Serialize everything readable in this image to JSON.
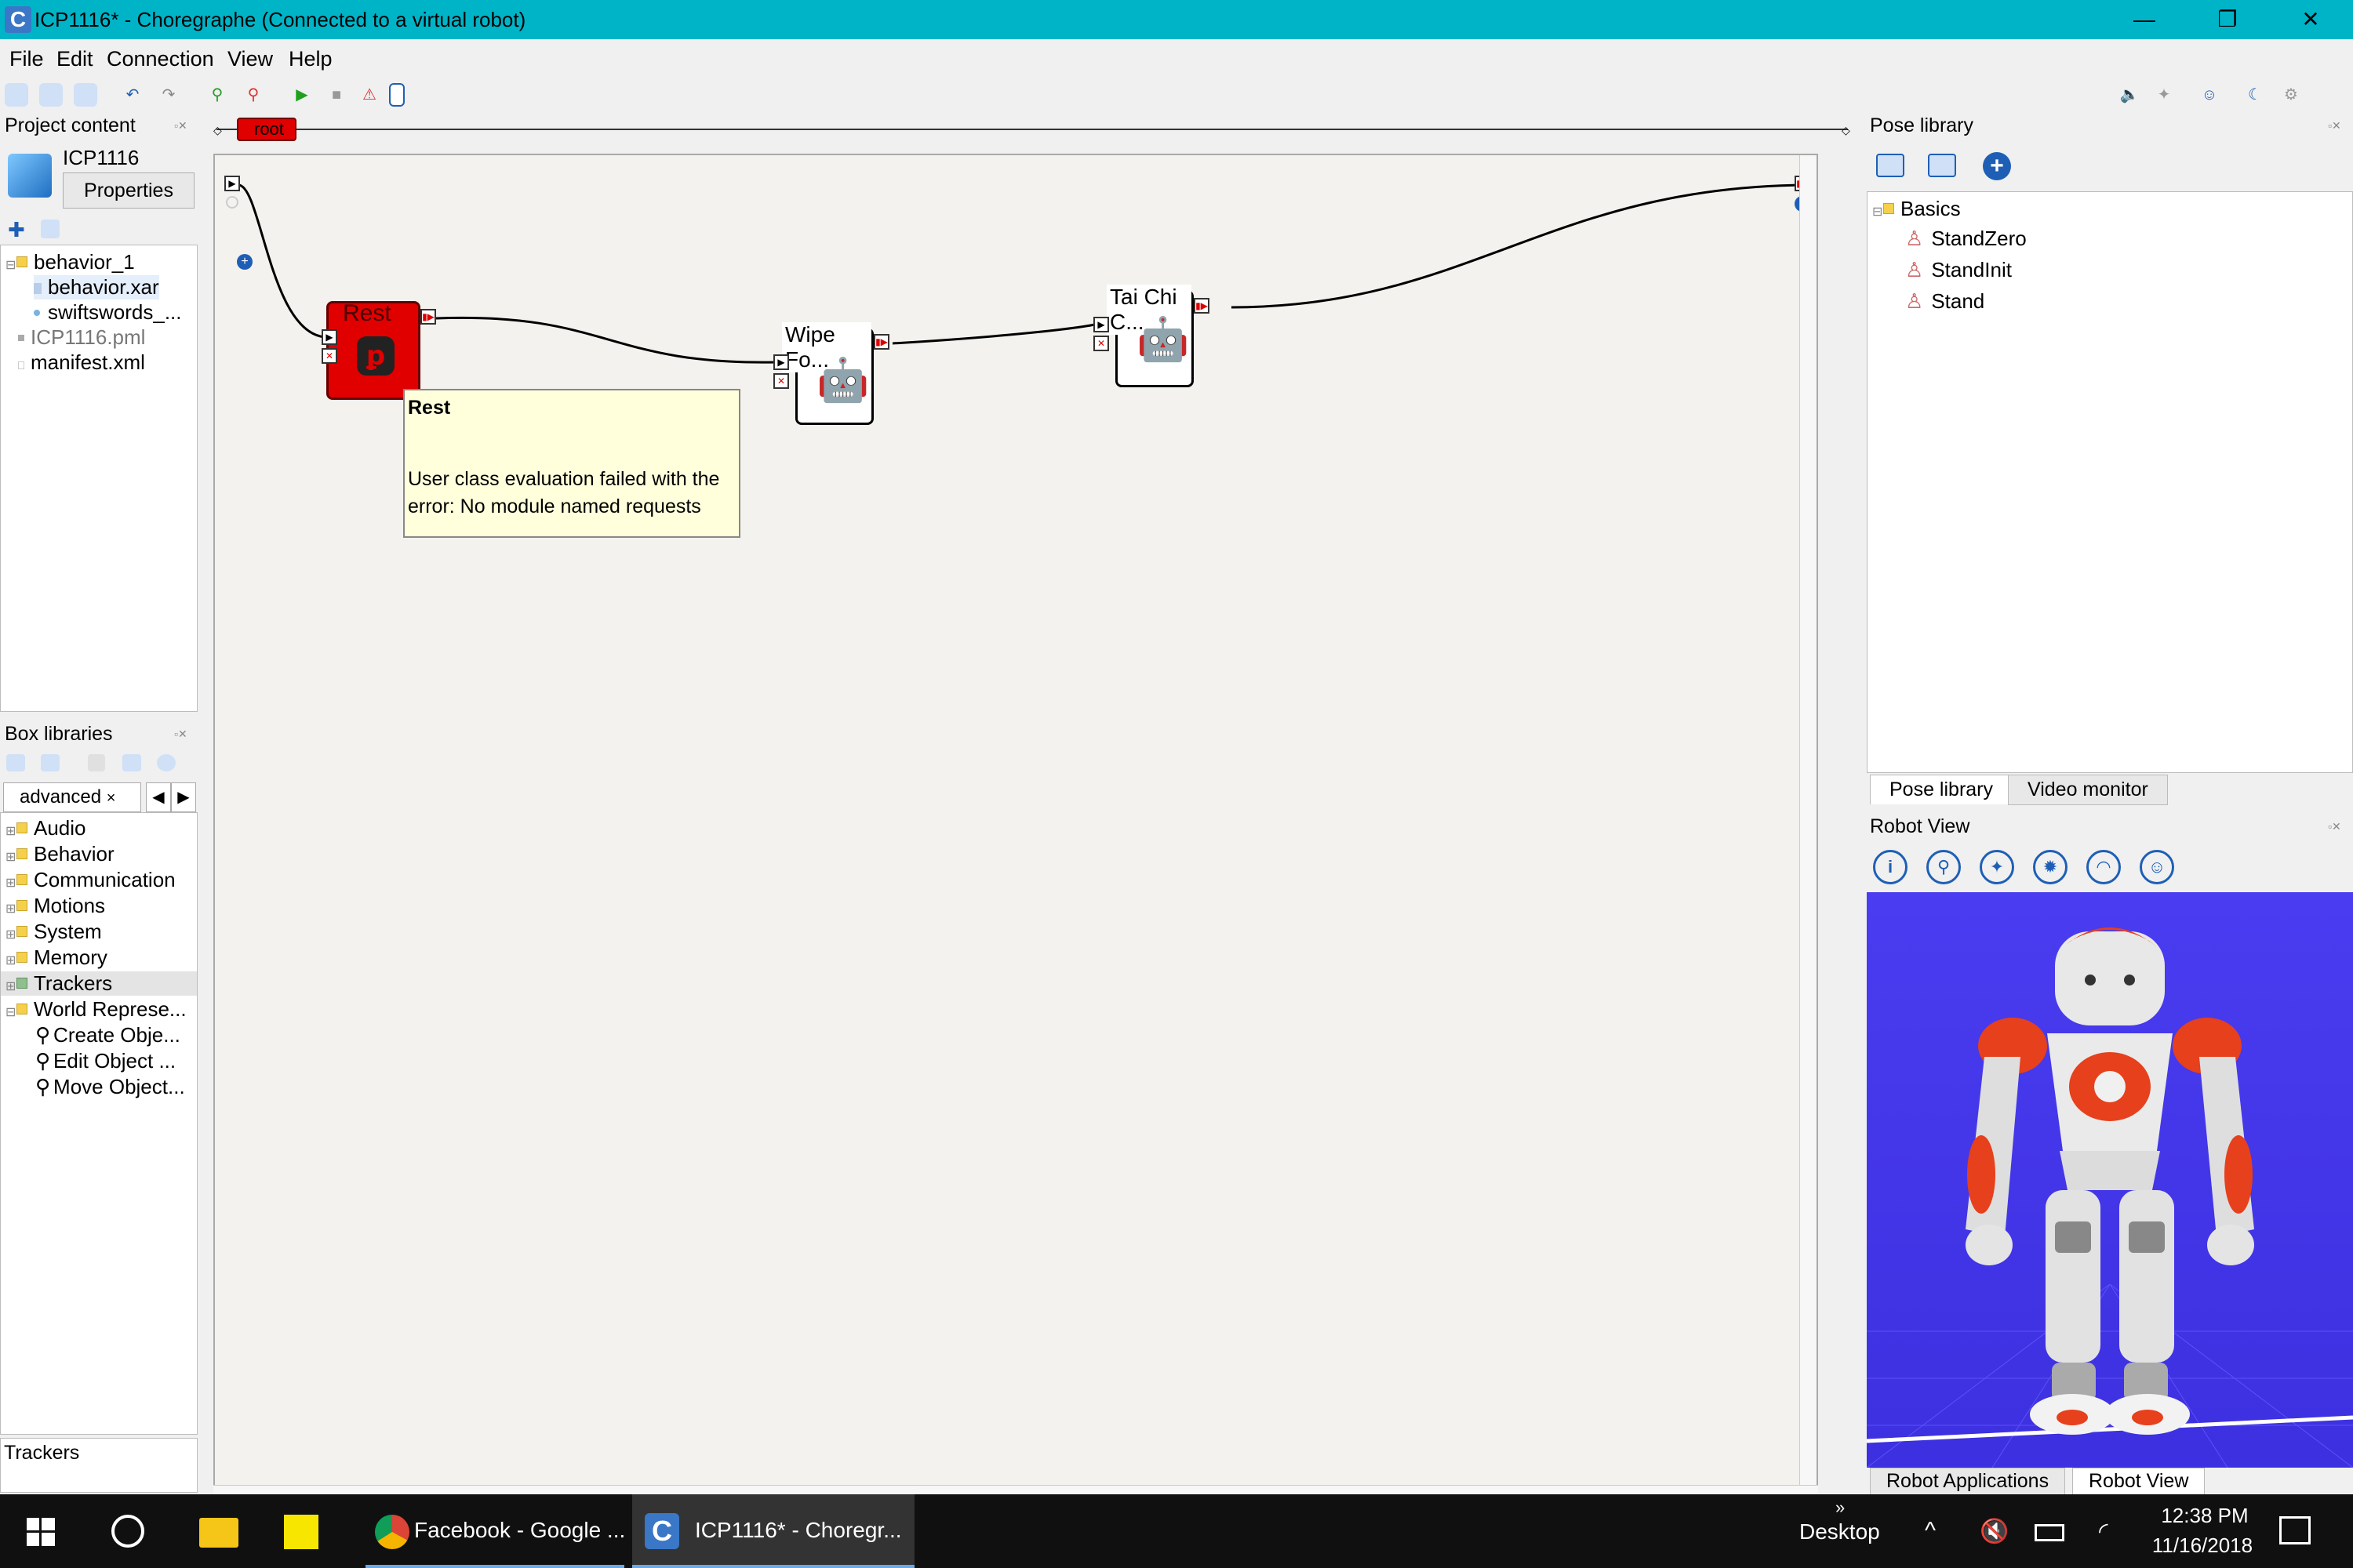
{
  "window": {
    "title": "ICP1116* - Choregraphe (Connected to a virtual robot)",
    "app_icon_letter": "C"
  },
  "window_controls": {
    "minimize": "—",
    "maximize": "❐",
    "close": "✕"
  },
  "menu": [
    "File",
    "Edit",
    "Connection",
    "View",
    "Help"
  ],
  "breadcrumb": {
    "root_label": "root"
  },
  "project_content": {
    "title": "Project content",
    "project_name": "ICP1116",
    "properties_button": "Properties",
    "tree": [
      {
        "label": "behavior_1"
      },
      {
        "label": "behavior.xar"
      },
      {
        "label": "swiftswords_..."
      },
      {
        "label": "ICP1116.pml"
      },
      {
        "label": "manifest.xml"
      }
    ]
  },
  "box_libraries": {
    "title": "Box libraries",
    "active_tab": "advanced",
    "tab_close": "×",
    "items": [
      {
        "label": "Audio"
      },
      {
        "label": "Behavior"
      },
      {
        "label": "Communication"
      },
      {
        "label": "Motions"
      },
      {
        "label": "System"
      },
      {
        "label": "Memory"
      },
      {
        "label": "Trackers"
      },
      {
        "label": "World Represe..."
      },
      {
        "label": "Create Obje..."
      },
      {
        "label": "Edit Object ..."
      },
      {
        "label": "Move Object..."
      }
    ]
  },
  "bottom_left": {
    "label": "Trackers"
  },
  "canvas": {
    "boxes": [
      {
        "title": "Rest",
        "type": "python",
        "state": "error"
      },
      {
        "title": "Wipe Fo...",
        "type": "motion"
      },
      {
        "title": "Tai Chi C...",
        "type": "motion"
      }
    ],
    "tooltip": {
      "title": "Rest",
      "line1": "User class evaluation failed with the",
      "line2": "error: No module named requests"
    }
  },
  "pose_library": {
    "title": "Pose library",
    "folder": "Basics",
    "items": [
      "StandZero",
      "StandInit",
      "Stand"
    ],
    "tabs": [
      "Pose library",
      "Video monitor"
    ]
  },
  "robot_view": {
    "title": "Robot View",
    "tabs": [
      "Robot Applications",
      "Robot View"
    ],
    "icons": [
      "info-icon",
      "robot-settings-icon",
      "sparkle-icon",
      "gear-robot-icon",
      "head-icon",
      "face-icon"
    ]
  },
  "taskbar": {
    "apps": [
      {
        "label": "Facebook - Google ..."
      },
      {
        "label": "ICP1116* - Choregr..."
      }
    ],
    "desktop_label": "Desktop",
    "time": "12:38 PM",
    "date": "11/16/2018"
  },
  "colors": {
    "titlebar": "#00b4c8",
    "error_box": "#e00000",
    "robot_bg": "#4a3cf0",
    "accent_blue": "#1e5fb5"
  }
}
